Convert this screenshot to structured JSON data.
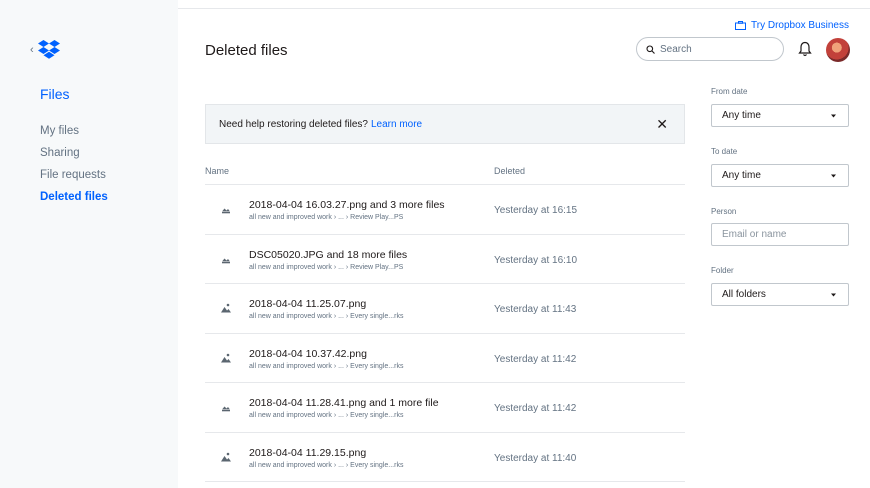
{
  "app": {
    "try_business": "Try Dropbox Business",
    "page_title": "Deleted files"
  },
  "sidebar": {
    "section_title": "Files",
    "items": [
      {
        "label": "My files",
        "active": false
      },
      {
        "label": "Sharing",
        "active": false
      },
      {
        "label": "File requests",
        "active": false
      },
      {
        "label": "Deleted files",
        "active": true
      }
    ]
  },
  "search": {
    "placeholder": "Search"
  },
  "banner": {
    "text": "Need help restoring deleted files?",
    "link": "Learn more",
    "close": "✕"
  },
  "table": {
    "headers": {
      "name": "Name",
      "deleted": "Deleted"
    },
    "rows": [
      {
        "name": "2018-04-04 16.03.27.png and 3 more files",
        "path": "all new and improved work › ... › Review Play...PS",
        "deleted": "Yesterday at 16:15",
        "icon": "file-stack-icon"
      },
      {
        "name": "DSC05020.JPG and 18 more files",
        "path": "all new and improved work › ... › Review Play...PS",
        "deleted": "Yesterday at 16:10",
        "icon": "file-stack-icon"
      },
      {
        "name": "2018-04-04 11.25.07.png",
        "path": "all new and improved work › ... › Every single...rks",
        "deleted": "Yesterday at 11:43",
        "icon": "image-file-icon"
      },
      {
        "name": "2018-04-04 10.37.42.png",
        "path": "all new and improved work › ... › Every single...rks",
        "deleted": "Yesterday at 11:42",
        "icon": "image-file-icon"
      },
      {
        "name": "2018-04-04 11.28.41.png and 1 more file",
        "path": "all new and improved work › ... › Every single...rks",
        "deleted": "Yesterday at 11:42",
        "icon": "file-stack-icon"
      },
      {
        "name": "2018-04-04 11.29.15.png",
        "path": "all new and improved work › ... › Every single...rks",
        "deleted": "Yesterday at 11:40",
        "icon": "image-file-icon"
      }
    ]
  },
  "filters": {
    "from_date": {
      "label": "From date",
      "value": "Any time"
    },
    "to_date": {
      "label": "To date",
      "value": "Any time"
    },
    "person": {
      "label": "Person",
      "placeholder": "Email or name"
    },
    "folder": {
      "label": "Folder",
      "value": "All folders"
    }
  },
  "colors": {
    "accent": "#0061fe",
    "muted": "#637282",
    "sidebar_bg": "#f7f9fa"
  }
}
